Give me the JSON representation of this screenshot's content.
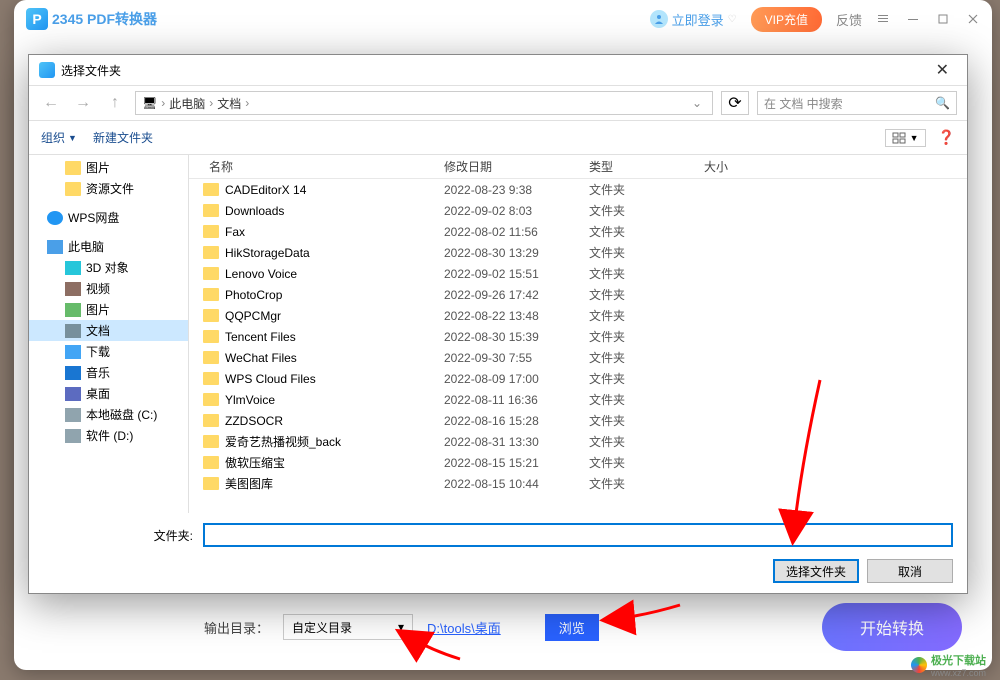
{
  "app": {
    "logo_letter": "P",
    "title": "2345 PDF转换器",
    "login": "立即登录",
    "vip": "VIP充值",
    "feedback": "反馈"
  },
  "bottom": {
    "out_label": "输出目录：",
    "select_value": "自定义目录",
    "path": "D:\\tools\\桌面",
    "browse": "浏览",
    "convert": "开始转换"
  },
  "dialog": {
    "title": "选择文件夹",
    "breadcrumb": {
      "pc": "此电脑",
      "docs": "文档"
    },
    "search_placeholder": "在 文档 中搜索",
    "organize": "组织",
    "newfolder": "新建文件夹",
    "columns": {
      "name": "名称",
      "date": "修改日期",
      "type": "类型",
      "size": "大小"
    },
    "folder_label": "文件夹:",
    "select_btn": "选择文件夹",
    "cancel_btn": "取消"
  },
  "tree": [
    {
      "label": "图片",
      "icon": "ic-folder",
      "level": 2
    },
    {
      "label": "资源文件",
      "icon": "ic-folder",
      "level": 2
    },
    {
      "label": "WPS网盘",
      "icon": "ic-wps",
      "level": 1,
      "gapTop": true
    },
    {
      "label": "此电脑",
      "icon": "ic-pc",
      "level": 1,
      "gapTop": true
    },
    {
      "label": "3D 对象",
      "icon": "ic-3d",
      "level": 2
    },
    {
      "label": "视频",
      "icon": "ic-video",
      "level": 2
    },
    {
      "label": "图片",
      "icon": "ic-pic",
      "level": 2
    },
    {
      "label": "文档",
      "icon": "ic-doc",
      "level": 2,
      "selected": true
    },
    {
      "label": "下载",
      "icon": "ic-dl",
      "level": 2
    },
    {
      "label": "音乐",
      "icon": "ic-music",
      "level": 2
    },
    {
      "label": "桌面",
      "icon": "ic-desk",
      "level": 2
    },
    {
      "label": "本地磁盘 (C:)",
      "icon": "ic-disk",
      "level": 2
    },
    {
      "label": "软件 (D:)",
      "icon": "ic-disk",
      "level": 2
    }
  ],
  "files": [
    {
      "name": "CADEditorX 14",
      "date": "2022-08-23 9:38",
      "type": "文件夹"
    },
    {
      "name": "Downloads",
      "date": "2022-09-02 8:03",
      "type": "文件夹"
    },
    {
      "name": "Fax",
      "date": "2022-08-02 11:56",
      "type": "文件夹"
    },
    {
      "name": "HikStorageData",
      "date": "2022-08-30 13:29",
      "type": "文件夹"
    },
    {
      "name": "Lenovo Voice",
      "date": "2022-09-02 15:51",
      "type": "文件夹"
    },
    {
      "name": "PhotoCrop",
      "date": "2022-09-26 17:42",
      "type": "文件夹"
    },
    {
      "name": "QQPCMgr",
      "date": "2022-08-22 13:48",
      "type": "文件夹"
    },
    {
      "name": "Tencent Files",
      "date": "2022-08-30 15:39",
      "type": "文件夹"
    },
    {
      "name": "WeChat Files",
      "date": "2022-09-30 7:55",
      "type": "文件夹"
    },
    {
      "name": "WPS Cloud Files",
      "date": "2022-08-09 17:00",
      "type": "文件夹"
    },
    {
      "name": "YlmVoice",
      "date": "2022-08-11 16:36",
      "type": "文件夹"
    },
    {
      "name": "ZZDSOCR",
      "date": "2022-08-16 15:28",
      "type": "文件夹"
    },
    {
      "name": "爱奇艺热播视频_back",
      "date": "2022-08-31 13:30",
      "type": "文件夹"
    },
    {
      "name": "傲软压缩宝",
      "date": "2022-08-15 15:21",
      "type": "文件夹"
    },
    {
      "name": "美图图库",
      "date": "2022-08-15 10:44",
      "type": "文件夹"
    }
  ],
  "watermark": {
    "name": "极光下载站",
    "url": "www.xz7.com"
  }
}
